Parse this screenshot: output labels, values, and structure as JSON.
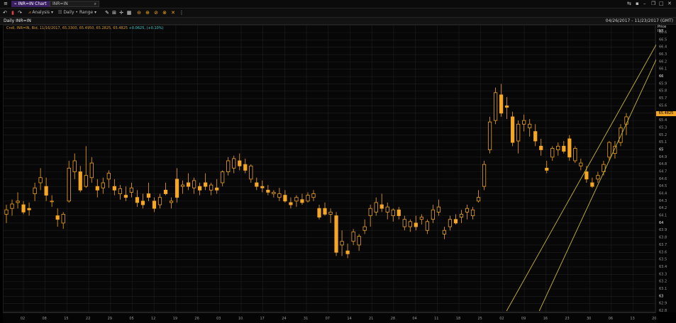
{
  "tabs": [
    {
      "label": "INR=IN Chart",
      "active": true
    },
    {
      "label": "INR=IN",
      "active": false
    }
  ],
  "toolbar": {
    "analysis_label": "Analysis",
    "interval_label": "Daily",
    "range_label": "Range"
  },
  "chart_header": {
    "title": "Daily INR=IN",
    "date_range": "04/26/2017 - 11/23/2017 (GMT)",
    "ohlc": "Cndl, INR=IN, Bid, 11/16/2017, 65.3300, 65.4950, 65.2825, 65.4825",
    "change": "+0.0625, (+0.10%)"
  },
  "price_axis": {
    "header_price": "Price",
    "header_unit": "INR",
    "last_price": "65.4825"
  },
  "colors": {
    "accent": "#f5a623",
    "tab_active": "#3b1f63",
    "trendline": "#c8b832",
    "grid": "#1f1f1f",
    "change_text": "#3fd0d0"
  },
  "chart_data": {
    "type": "candlestick",
    "x_tick_labels": [
      "02",
      "08",
      "15",
      "22",
      "29",
      "05",
      "12",
      "19",
      "26",
      "03",
      "10",
      "17",
      "24",
      "31",
      "07",
      "14",
      "21",
      "28",
      "04",
      "11",
      "18",
      "25",
      "02",
      "09",
      "16",
      "23",
      "30",
      "06",
      "13",
      "20"
    ],
    "ylim": [
      62.8,
      66.6
    ],
    "y_tick_labels": [
      "66.6",
      "66.5",
      "66.4",
      "66.3",
      "66.2",
      "66.1",
      "66",
      "65.9",
      "65.8",
      "65.7",
      "65.6",
      "65.5",
      "65.4",
      "65.3",
      "65.2",
      "65.1",
      "65",
      "64.9",
      "64.8",
      "64.7",
      "64.6",
      "64.5",
      "64.4",
      "64.3",
      "64.2",
      "64.1",
      "64",
      "63.9",
      "63.8",
      "63.7",
      "63.6",
      "63.5",
      "63.4",
      "63.3",
      "63.2",
      "63.1",
      "63",
      "62.9",
      "62.8"
    ],
    "candles": [
      [
        64.12,
        64.25,
        64.0,
        64.18
      ],
      [
        64.2,
        64.32,
        64.1,
        64.26
      ],
      [
        64.28,
        64.42,
        64.2,
        64.3
      ],
      [
        64.25,
        64.3,
        64.12,
        64.15
      ],
      [
        64.2,
        64.28,
        64.1,
        64.18
      ],
      [
        64.4,
        64.55,
        64.3,
        64.48
      ],
      [
        64.55,
        64.75,
        64.45,
        64.62
      ],
      [
        64.5,
        64.62,
        64.3,
        64.38
      ],
      [
        64.3,
        64.38,
        64.22,
        64.3
      ],
      [
        64.1,
        64.2,
        63.95,
        64.05
      ],
      [
        64.0,
        64.15,
        63.92,
        64.12
      ],
      [
        64.3,
        64.85,
        64.28,
        64.75
      ],
      [
        64.7,
        64.95,
        64.6,
        64.85
      ],
      [
        64.7,
        64.78,
        64.42,
        64.45
      ],
      [
        64.5,
        65.05,
        64.48,
        64.65
      ],
      [
        64.62,
        64.9,
        64.55,
        64.82
      ],
      [
        64.5,
        64.6,
        64.35,
        64.45
      ],
      [
        64.48,
        64.62,
        64.4,
        64.55
      ],
      [
        64.6,
        64.72,
        64.48,
        64.68
      ],
      [
        64.5,
        64.6,
        64.38,
        64.45
      ],
      [
        64.4,
        64.52,
        64.32,
        64.47
      ],
      [
        64.38,
        64.5,
        64.3,
        64.35
      ],
      [
        64.42,
        64.55,
        64.35,
        64.48
      ],
      [
        64.35,
        64.45,
        64.22,
        64.28
      ],
      [
        64.3,
        64.4,
        64.2,
        64.25
      ],
      [
        64.4,
        64.55,
        64.3,
        64.35
      ],
      [
        64.3,
        64.35,
        64.15,
        64.2
      ],
      [
        64.25,
        64.4,
        64.2,
        64.35
      ],
      [
        64.45,
        64.55,
        64.38,
        64.4
      ],
      [
        64.28,
        64.35,
        64.2,
        64.3
      ],
      [
        64.6,
        64.75,
        64.28,
        64.35
      ],
      [
        64.5,
        64.58,
        64.4,
        64.52
      ],
      [
        64.55,
        64.68,
        64.45,
        64.5
      ],
      [
        64.48,
        64.62,
        64.4,
        64.58
      ],
      [
        64.5,
        64.55,
        64.38,
        64.45
      ],
      [
        64.55,
        64.68,
        64.45,
        64.5
      ],
      [
        64.45,
        64.55,
        64.38,
        64.52
      ],
      [
        64.48,
        64.6,
        64.4,
        64.45
      ],
      [
        64.55,
        64.72,
        64.5,
        64.7
      ],
      [
        64.7,
        64.9,
        64.65,
        64.85
      ],
      [
        64.75,
        64.92,
        64.68,
        64.88
      ],
      [
        64.85,
        64.95,
        64.72,
        64.78
      ],
      [
        64.8,
        64.88,
        64.68,
        64.72
      ],
      [
        64.6,
        64.8,
        64.55,
        64.78
      ],
      [
        64.55,
        64.62,
        64.45,
        64.5
      ],
      [
        64.5,
        64.58,
        64.42,
        64.48
      ],
      [
        64.45,
        64.52,
        64.38,
        64.42
      ],
      [
        64.4,
        64.45,
        64.35,
        64.42
      ],
      [
        64.35,
        64.48,
        64.3,
        64.4
      ],
      [
        64.38,
        64.45,
        64.28,
        64.3
      ],
      [
        64.28,
        64.35,
        64.2,
        64.25
      ],
      [
        64.3,
        64.38,
        64.22,
        64.35
      ],
      [
        64.32,
        64.4,
        64.25,
        64.28
      ],
      [
        64.3,
        64.42,
        64.28,
        64.38
      ],
      [
        64.35,
        64.45,
        64.3,
        64.4
      ],
      [
        64.2,
        64.25,
        64.05,
        64.08
      ],
      [
        64.2,
        64.28,
        64.1,
        64.12
      ],
      [
        64.12,
        64.2,
        64.0,
        64.15
      ],
      [
        64.1,
        64.15,
        63.55,
        63.6
      ],
      [
        63.7,
        63.9,
        63.55,
        63.75
      ],
      [
        63.62,
        63.72,
        63.52,
        63.58
      ],
      [
        63.75,
        63.92,
        63.7,
        63.88
      ],
      [
        63.7,
        63.85,
        63.62,
        63.82
      ],
      [
        63.9,
        64.05,
        63.85,
        63.95
      ],
      [
        64.1,
        64.25,
        63.95,
        64.2
      ],
      [
        64.15,
        64.35,
        64.1,
        64.28
      ],
      [
        64.25,
        64.4,
        64.15,
        64.2
      ],
      [
        64.15,
        64.28,
        64.05,
        64.22
      ],
      [
        64.1,
        64.2,
        64.02,
        64.18
      ],
      [
        64.18,
        64.22,
        64.05,
        64.1
      ],
      [
        63.95,
        64.1,
        63.9,
        64.05
      ],
      [
        63.95,
        64.05,
        63.88,
        64.02
      ],
      [
        64.0,
        64.1,
        63.9,
        63.95
      ],
      [
        64.05,
        64.12,
        63.98,
        64.08
      ],
      [
        63.9,
        64.05,
        63.85,
        64.02
      ],
      [
        64.05,
        64.25,
        64.0,
        64.18
      ],
      [
        64.15,
        64.32,
        64.1,
        64.22
      ],
      [
        63.85,
        63.95,
        63.78,
        63.9
      ],
      [
        63.95,
        64.1,
        63.9,
        64.05
      ],
      [
        64.05,
        64.12,
        63.98,
        64.0
      ],
      [
        64.08,
        64.18,
        64.0,
        64.12
      ],
      [
        64.15,
        64.25,
        64.05,
        64.2
      ],
      [
        64.1,
        64.22,
        64.05,
        64.18
      ],
      [
        64.3,
        64.45,
        64.28,
        64.35
      ],
      [
        64.5,
        64.85,
        64.45,
        64.8
      ],
      [
        65.0,
        65.45,
        64.95,
        65.38
      ],
      [
        65.4,
        65.85,
        65.35,
        65.78
      ],
      [
        65.75,
        65.9,
        65.45,
        65.5
      ],
      [
        65.6,
        65.72,
        65.42,
        65.58
      ],
      [
        65.45,
        65.52,
        65.05,
        65.1
      ],
      [
        65.12,
        65.4,
        64.95,
        65.35
      ],
      [
        65.35,
        65.48,
        65.25,
        65.4
      ],
      [
        65.3,
        65.42,
        65.18,
        65.35
      ],
      [
        65.25,
        65.35,
        65.05,
        65.12
      ],
      [
        65.05,
        65.15,
        64.92,
        65.0
      ],
      [
        64.75,
        64.85,
        64.68,
        64.72
      ],
      [
        64.9,
        65.05,
        64.85,
        65.02
      ],
      [
        65.0,
        65.1,
        64.92,
        65.05
      ],
      [
        65.05,
        65.12,
        64.95,
        64.98
      ],
      [
        65.15,
        65.2,
        64.85,
        64.9
      ],
      [
        64.85,
        65.05,
        64.82,
        65.02
      ],
      [
        64.78,
        64.88,
        64.72,
        64.82
      ],
      [
        64.7,
        64.78,
        64.55,
        64.6
      ],
      [
        64.55,
        64.62,
        64.48,
        64.5
      ],
      [
        64.6,
        64.7,
        64.55,
        64.65
      ],
      [
        64.7,
        64.85,
        64.65,
        64.8
      ],
      [
        64.9,
        65.12,
        64.85,
        65.1
      ],
      [
        64.95,
        65.12,
        64.88,
        65.05
      ],
      [
        65.1,
        65.35,
        65.05,
        65.3
      ],
      [
        65.35,
        65.5,
        65.2,
        65.45
      ]
    ],
    "trendlines": [
      {
        "x0": 0.77,
        "y0": 62.8,
        "x1": 1.0,
        "y1": 66.45
      },
      {
        "x0": 0.82,
        "y0": 62.8,
        "x1": 1.0,
        "y1": 66.25
      }
    ]
  }
}
